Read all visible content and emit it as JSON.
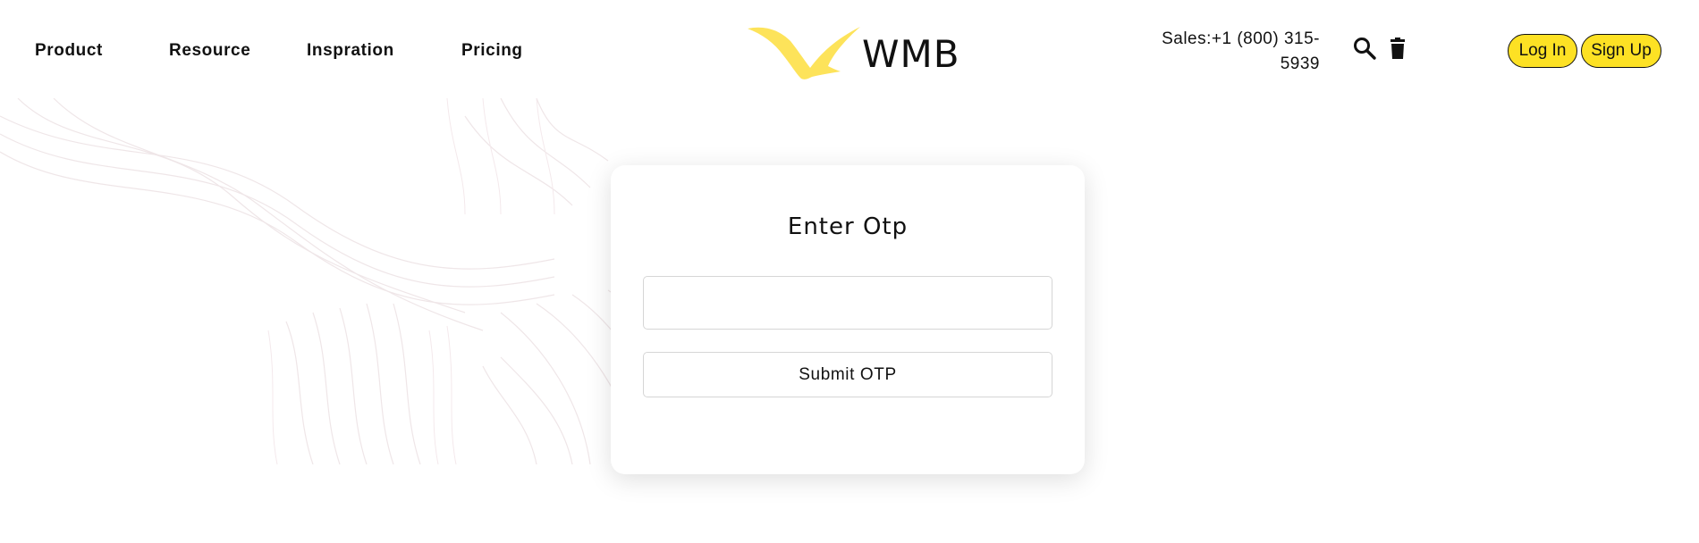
{
  "nav": {
    "items": [
      {
        "label": "Product"
      },
      {
        "label": "Resource"
      },
      {
        "label": "Inspration"
      },
      {
        "label": "Pricing"
      }
    ]
  },
  "logo": {
    "text": "WMB",
    "color": "#fde35a"
  },
  "header": {
    "sales_line1": "Sales:+1 (800) 315-",
    "sales_line2": "5939",
    "search_icon": "search-icon",
    "trash_icon": "trash-icon",
    "login_label": "Log In",
    "signup_label": "Sign Up",
    "accent": "#fde124"
  },
  "otp_card": {
    "title": "Enter Otp",
    "input_value": "",
    "input_placeholder": "",
    "submit_label": "Submit OTP"
  }
}
